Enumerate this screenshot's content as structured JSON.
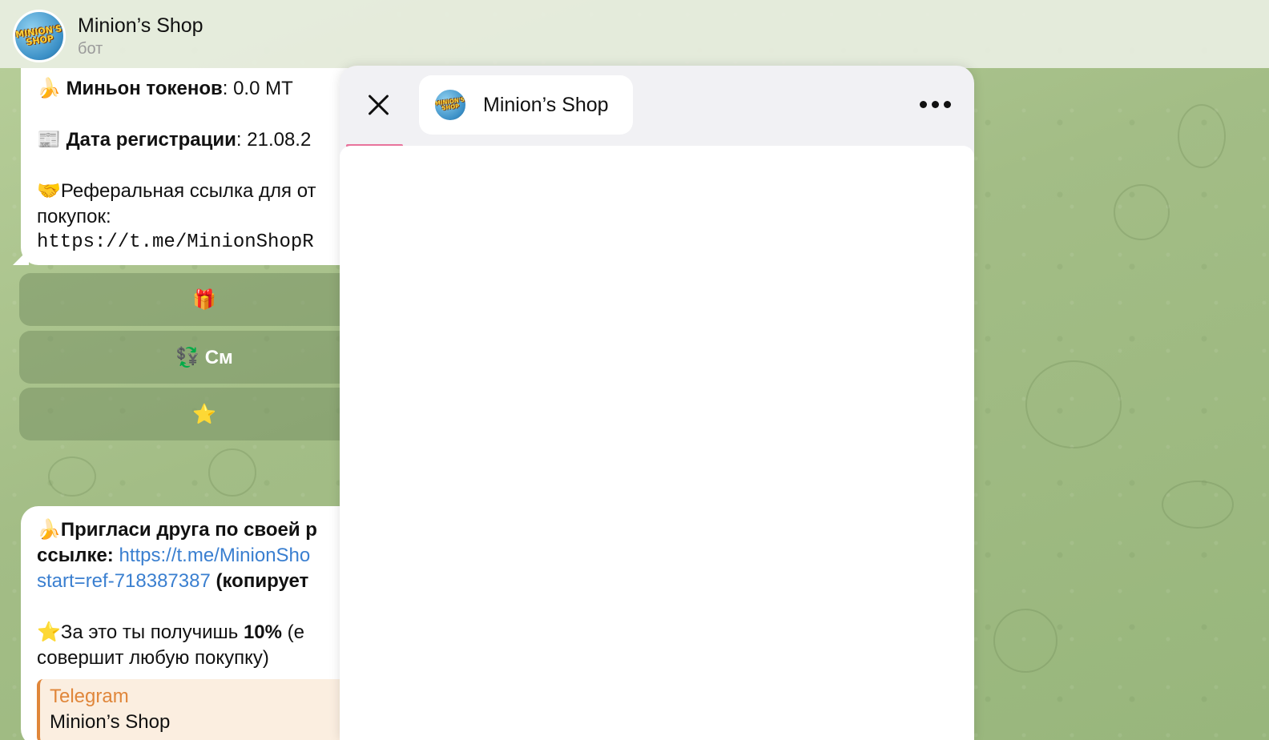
{
  "header": {
    "title": "Minion’s Shop",
    "subtitle": "бот",
    "avatar_text": "MINION'S SHOP"
  },
  "message1": {
    "tokens_emoji": "🍌",
    "tokens_label": "Миньон токенов",
    "tokens_value": ": 0.0 MT",
    "date_emoji": "📰",
    "date_label": "Дата регистрации",
    "date_value": ": 21.08.2",
    "ref_emoji": "🤝",
    "ref_text": "Реферальная ссылка для от",
    "ref_text2": "покупок:",
    "ref_link": "https://t.me/MinionShopR"
  },
  "keyboard": [
    {
      "label": "🎁"
    },
    {
      "label": "💱 См"
    },
    {
      "label": "⭐"
    }
  ],
  "message2": {
    "emoji": "🍌",
    "invite_bold": "Пригласи друга по своей р",
    "invite_bold2": "ссылке: ",
    "invite_link": "https://t.me/MinionSho",
    "invite_link2": "start=ref-718387387",
    "invite_copy": " (копирует",
    "star_emoji": "⭐",
    "reward_text": "За это ты получишь ",
    "reward_percent": "10%",
    "reward_tail": " (е",
    "reward_text2": "совершит любую покупку)",
    "preview_site": "Telegram",
    "preview_title": "Minion’s Shop"
  },
  "miniapp": {
    "title": "Minion’s Shop",
    "close_icon": "close-icon",
    "more_icon": "more-dots-icon",
    "progress": 0.09,
    "accent_color": "#e8739c"
  }
}
